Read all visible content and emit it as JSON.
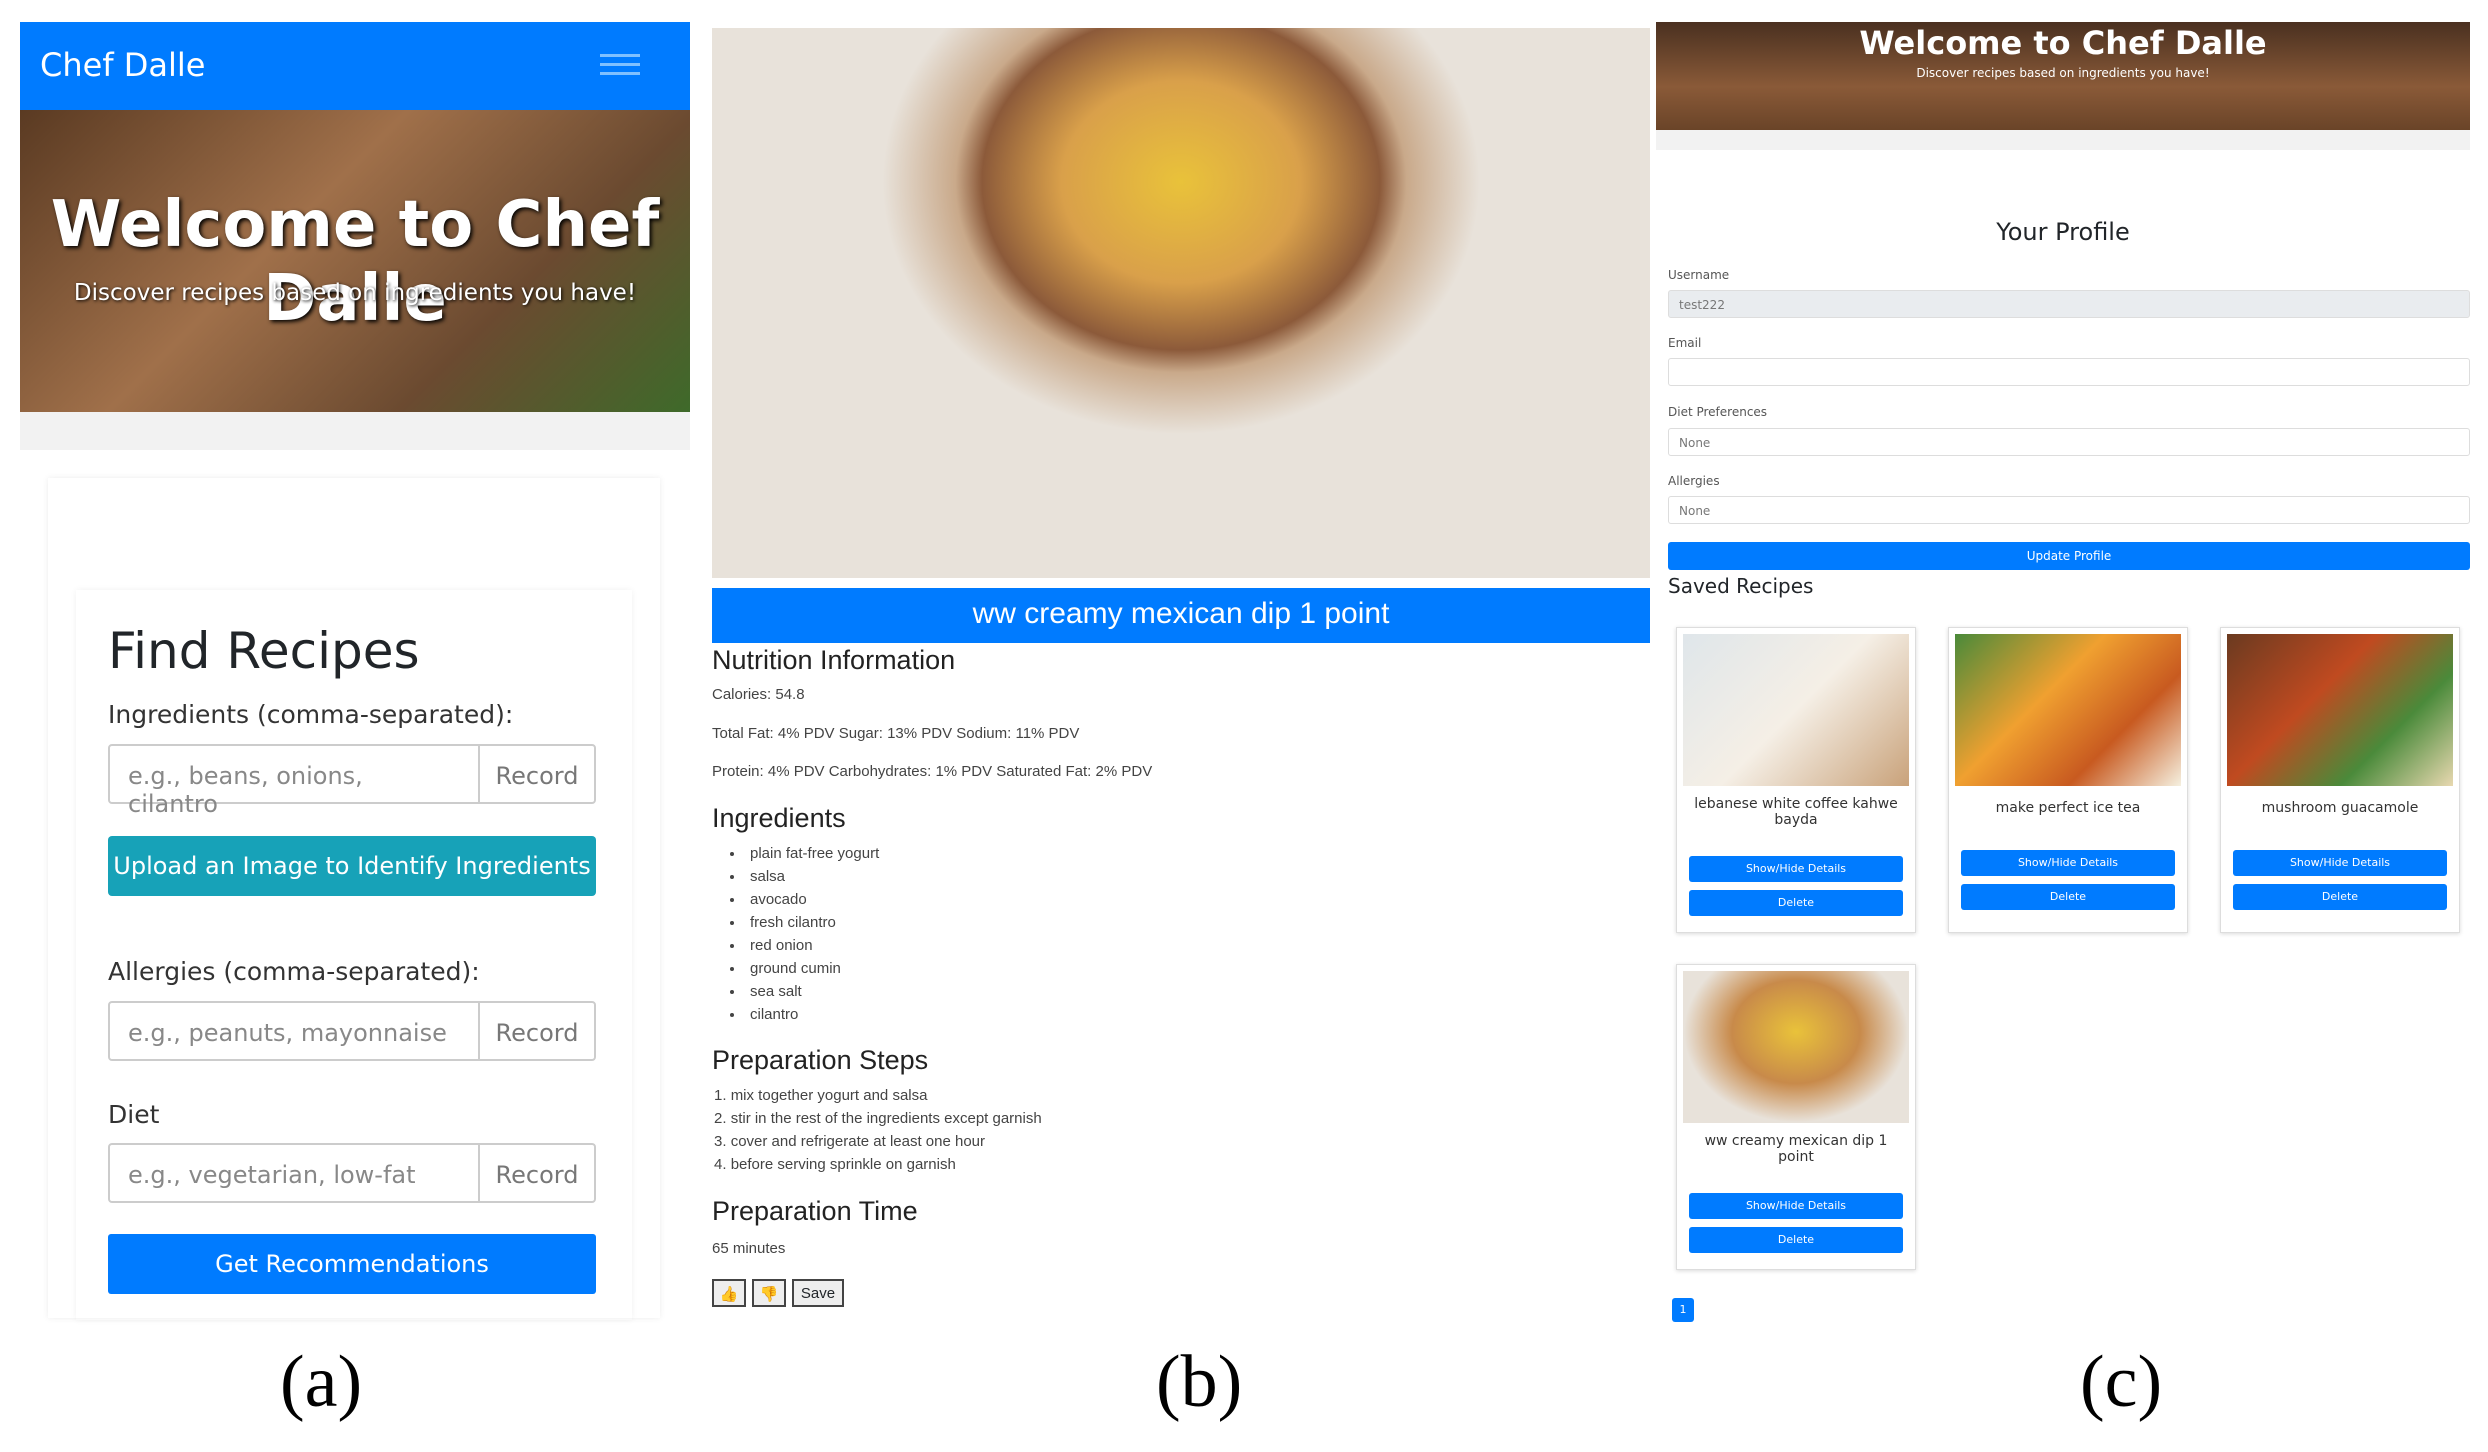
{
  "panel_a": {
    "brand": "Chef Dalle",
    "hero_title": "Welcome to Chef Dalle",
    "hero_subtitle": "Discover recipes based on ingredients you have!",
    "heading": "Find Recipes",
    "ingredients_label": "Ingredients (comma-separated):",
    "ingredients_placeholder": "e.g., beans, onions, cilantro",
    "record": "Record",
    "upload": "Upload an Image to Identify Ingredients",
    "allergies_label": "Allergies (comma-separated):",
    "allergies_placeholder": "e.g., peanuts, mayonnaise",
    "diet_label": "Diet",
    "diet_placeholder": "e.g., vegetarian, low-fat",
    "submit": "Get Recommendations"
  },
  "panel_b": {
    "title": "ww creamy mexican dip 1 point",
    "nutrition_heading": "Nutrition Information",
    "calories": "Calories: 54.8",
    "nutrition_line1": "Total Fat: 4% PDV Sugar: 13% PDV Sodium: 11% PDV",
    "nutrition_line2": "Protein: 4% PDV Carbohydrates: 1% PDV Saturated Fat: 2% PDV",
    "ingredients_heading": "Ingredients",
    "ingredients": [
      "plain fat-free yogurt",
      "salsa",
      "avocado",
      "fresh cilantro",
      "red onion",
      "ground cumin",
      "sea salt",
      "cilantro"
    ],
    "steps_heading": "Preparation Steps",
    "steps": [
      "mix together yogurt and salsa",
      "stir in the rest of the ingredients except garnish",
      "cover and refrigerate at least one hour",
      "before serving sprinkle on garnish"
    ],
    "time_heading": "Preparation Time",
    "time": "65 minutes",
    "like": "👍",
    "dislike": "👎",
    "save": "Save"
  },
  "panel_c": {
    "hero_title": "Welcome to Chef Dalle",
    "hero_subtitle": "Discover recipes based on ingredients you have!",
    "heading": "Your Profile",
    "username_label": "Username",
    "username": "test222",
    "email_label": "Email",
    "email": "",
    "diet_label": "Diet Preferences",
    "diet": "None",
    "allergies_label": "Allergies",
    "allergies": "None",
    "update": "Update Profile",
    "saved_heading": "Saved Recipes",
    "recipes": [
      {
        "name": "lebanese white coffee kahwe bayda"
      },
      {
        "name": "make perfect ice tea"
      },
      {
        "name": "mushroom guacamole"
      },
      {
        "name": "ww creamy mexican dip 1 point"
      }
    ],
    "toggle": "Show/Hide Details",
    "delete": "Delete",
    "page": "1"
  },
  "captions": [
    "(a)",
    "(b)",
    "(c)"
  ],
  "colors": {
    "primary": "#007bff",
    "teal": "#17a2b8"
  }
}
